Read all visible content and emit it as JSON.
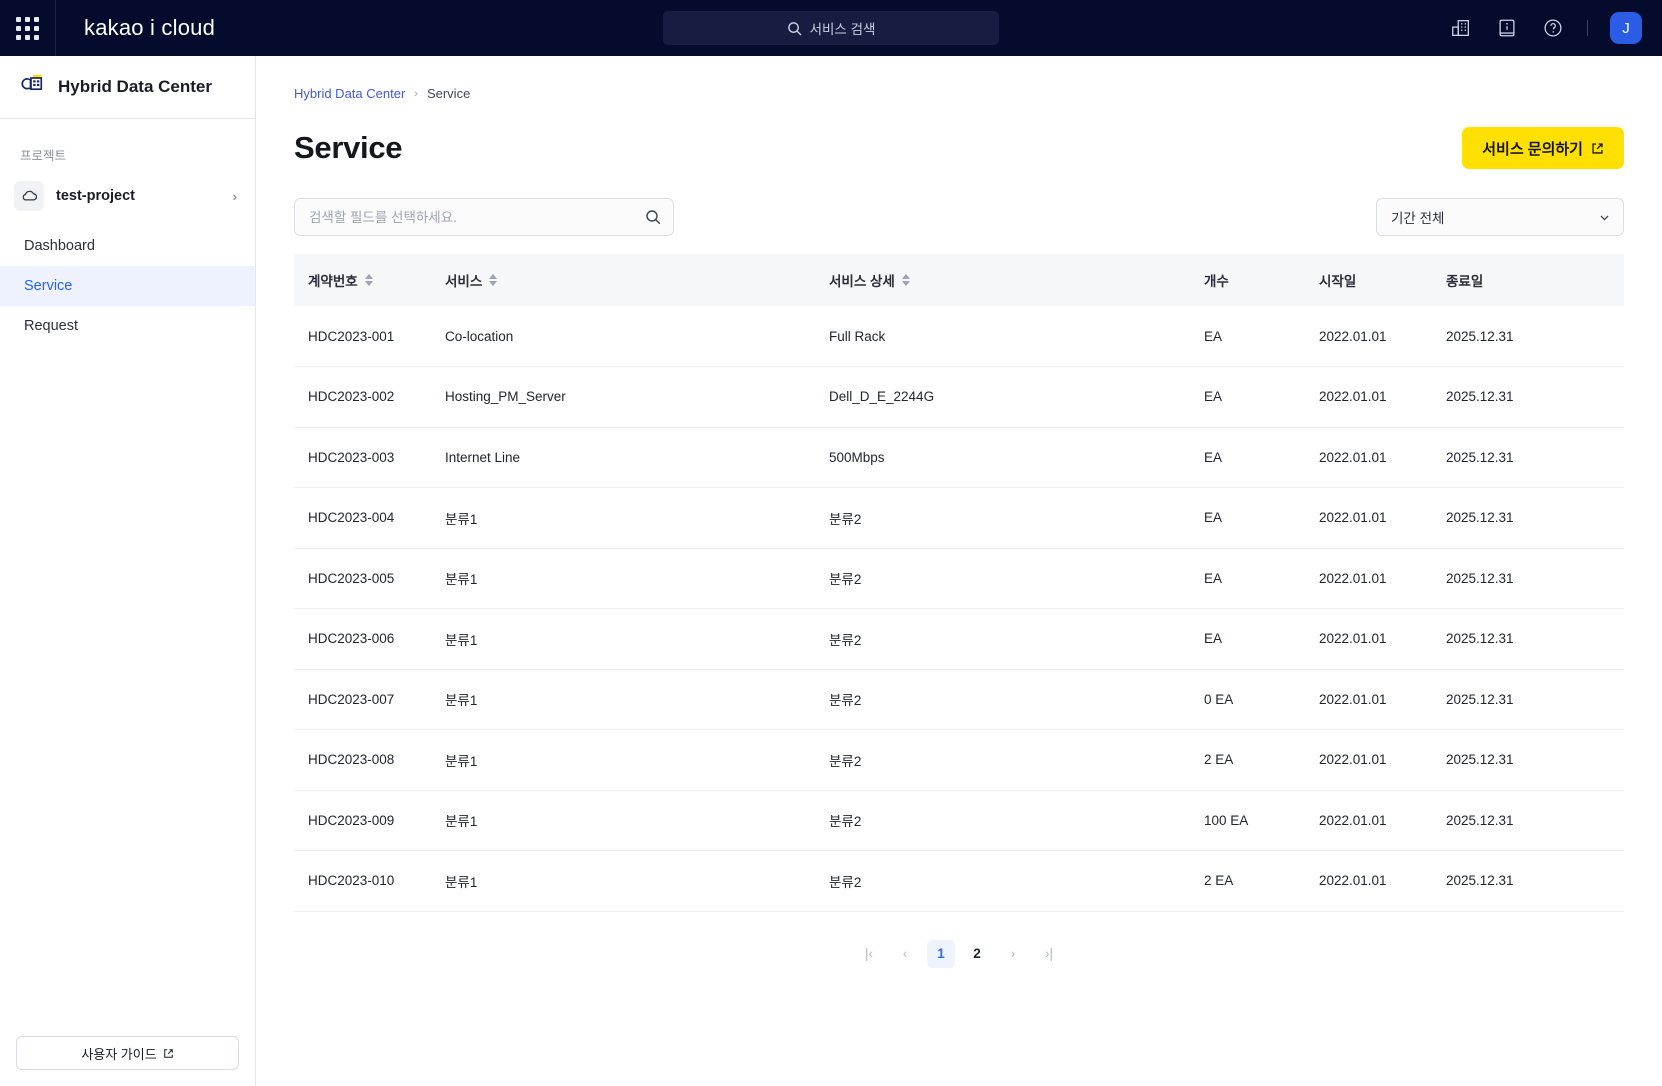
{
  "header": {
    "apps_icon": "grid-apps-icon",
    "brand": "kakao i cloud",
    "search_placeholder": "서비스 검색",
    "search_icon": "search-icon",
    "icons": [
      {
        "name": "datacenter-icon"
      },
      {
        "name": "info-book-icon"
      },
      {
        "name": "help-circle-icon"
      }
    ],
    "avatar_initial": "J"
  },
  "sidebar": {
    "logo_icon": "hybrid-data-center-cloud-icon",
    "title": "Hybrid Data Center",
    "section_label": "프로젝트",
    "project": {
      "icon": "cloud-icon",
      "name": "test-project",
      "chevron": "chevron-right-icon"
    },
    "items": [
      {
        "label": "Dashboard",
        "active": false
      },
      {
        "label": "Service",
        "active": true
      },
      {
        "label": "Request",
        "active": false
      }
    ],
    "guide_button": {
      "label": "사용자 가이드",
      "icon": "external-link-icon"
    }
  },
  "breadcrumb": {
    "root": "Hybrid Data Center",
    "separator": "›",
    "current": "Service"
  },
  "page": {
    "title": "Service",
    "inquiry_button": {
      "label": "서비스 문의하기",
      "icon": "external-link-icon",
      "color": "#ffe000"
    }
  },
  "filters": {
    "search_placeholder": "검색할 필드를 선택하세요.",
    "search_value": "",
    "search_icon": "search-icon",
    "period_selected": "기간 전체",
    "period_chevron": "chevron-down-icon"
  },
  "table": {
    "columns": [
      {
        "label": "계약번호",
        "sortable": true
      },
      {
        "label": "서비스",
        "sortable": true
      },
      {
        "label": "서비스 상세",
        "sortable": true
      },
      {
        "label": "개수",
        "sortable": false
      },
      {
        "label": "시작일",
        "sortable": false
      },
      {
        "label": "종료일",
        "sortable": false
      }
    ],
    "rows": [
      {
        "contract": "HDC2023-001",
        "service": "Co-location",
        "detail": "Full Rack",
        "count": "EA",
        "start": "2022.01.01",
        "end": "2025.12.31"
      },
      {
        "contract": "HDC2023-002",
        "service": "Hosting_PM_Server",
        "detail": "Dell_D_E_2244G",
        "count": "EA",
        "start": "2022.01.01",
        "end": "2025.12.31"
      },
      {
        "contract": "HDC2023-003",
        "service": "Internet Line",
        "detail": "500Mbps",
        "count": "EA",
        "start": "2022.01.01",
        "end": "2025.12.31"
      },
      {
        "contract": "HDC2023-004",
        "service": "분류1",
        "detail": "분류2",
        "count": "EA",
        "start": "2022.01.01",
        "end": "2025.12.31"
      },
      {
        "contract": "HDC2023-005",
        "service": "분류1",
        "detail": "분류2",
        "count": "EA",
        "start": "2022.01.01",
        "end": "2025.12.31"
      },
      {
        "contract": "HDC2023-006",
        "service": "분류1",
        "detail": "분류2",
        "count": "EA",
        "start": "2022.01.01",
        "end": "2025.12.31"
      },
      {
        "contract": "HDC2023-007",
        "service": "분류1",
        "detail": "분류2",
        "count": "0 EA",
        "start": "2022.01.01",
        "end": "2025.12.31"
      },
      {
        "contract": "HDC2023-008",
        "service": "분류1",
        "detail": "분류2",
        "count": "2 EA",
        "start": "2022.01.01",
        "end": "2025.12.31"
      },
      {
        "contract": "HDC2023-009",
        "service": "분류1",
        "detail": "분류2",
        "count": "100 EA",
        "start": "2022.01.01",
        "end": "2025.12.31"
      },
      {
        "contract": "HDC2023-010",
        "service": "분류1",
        "detail": "분류2",
        "count": "2 EA",
        "start": "2022.01.01",
        "end": "2025.12.31"
      }
    ]
  },
  "pagination": {
    "first": "|‹",
    "prev": "‹",
    "pages": [
      {
        "label": "1",
        "active": true
      },
      {
        "label": "2",
        "active": false
      }
    ],
    "next": "›",
    "last": "›|"
  }
}
